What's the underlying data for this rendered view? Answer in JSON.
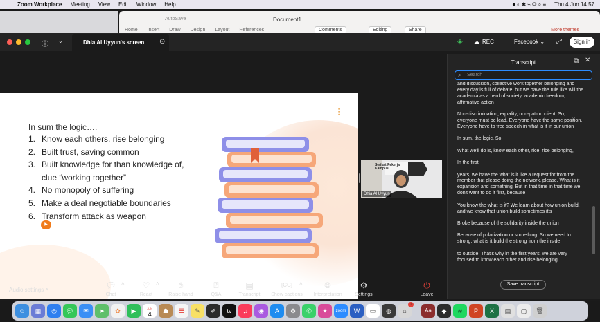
{
  "menubar": {
    "app": "Zoom Workplace",
    "items": [
      "Meeting",
      "View",
      "Edit",
      "Window",
      "Help"
    ],
    "date_time": "Thu 4 Jun  14.57"
  },
  "word_window": {
    "autosave": "AutoSave",
    "title": "Document1",
    "tabs": [
      "Home",
      "Insert",
      "Draw",
      "Design",
      "Layout",
      "References"
    ],
    "comments": "Comments",
    "editing": "Editing",
    "share": "Share",
    "more": "More themes"
  },
  "zoom": {
    "tab_label": "Dhia Al Uyyun's screen",
    "rec_label": "REC",
    "facebook_label": "Facebook",
    "signin_label": "Sign in"
  },
  "slide": {
    "heading": "In sum the logic….",
    "items": [
      {
        "num": "1.",
        "text": "Know each others, rise belonging"
      },
      {
        "num": "2.",
        "text": "Built trust, saving common"
      },
      {
        "num": "3.",
        "text": "Built knowledge for than knowledge of,"
      },
      {
        "num": "",
        "text": "clue “working together”"
      },
      {
        "num": "4.",
        "text": "No monopoly of suffering"
      },
      {
        "num": "5.",
        "text": "Make a deal negotiable boundaries"
      },
      {
        "num": "6.",
        "text": "Transform attack as weapon"
      }
    ]
  },
  "video": {
    "name": "Dhia Al Uyyun",
    "banner_text": "Serikat Pekerja Kampus"
  },
  "transcript": {
    "title": "Transcript",
    "search_placeholder": "Search",
    "paragraphs": [
      "and discussion, collective work together belonging and every day is full of debate, but we have the rule like will the academia as a herd of society, academic freedom, affirmative action",
      "Non-discrimination, equality, non-patron client. So, everyone must be lead. Everyone have the same position. Everyone have to free speech in what is it in our union",
      "In sum, the logic. So",
      "What we'll do is, know each other, rice, rice belonging,",
      "In the first",
      "years, we have the what is it like a request for from the member that please doing the network, please. What is it expansion and something. But in that time in that time we don't want to do it first, because",
      "You know the what is it? We learn about how union build, and we know that union build sometimes it's",
      "Broke because of the solidarity inside the union",
      "Because of polarization or something. So we need to strong, what is it build the strong from the inside",
      "to outside. That's why in the first years, we are very focused to know each other and rise belonging"
    ],
    "save_label": "Save transcript"
  },
  "toolbar": {
    "audio_settings": "Audio settings",
    "chat": "Chat",
    "react": "React",
    "raise_hand": "Raise hand",
    "qa": "Q&A",
    "transcript": "Transcript",
    "show_captions": "Show captions",
    "interpretation": "Interpretation",
    "settings": "Settings",
    "leave": "Leave"
  },
  "dock": {
    "calendar_month": "JUN",
    "calendar_day": "4",
    "notification_badge": "1"
  },
  "colors": {
    "accent_blue": "#2d8cff",
    "leave_red": "#e5423a",
    "slide_orange": "#f07b1b"
  }
}
